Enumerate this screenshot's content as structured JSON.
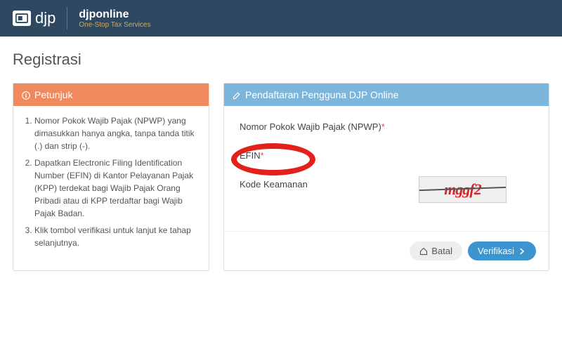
{
  "header": {
    "logo_text": "djp",
    "brand_title": "djponline",
    "brand_sub": "One-Stop Tax Services"
  },
  "page_title": "Registrasi",
  "instructions": {
    "title": "Petunjuk",
    "items": [
      "Nomor Pokok Wajib Pajak (NPWP) yang dimasukkan hanya angka, tanpa tanda titik (.) dan strip (-).",
      "Dapatkan Electronic Filing Identification Number (EFIN) di Kantor Pelayanan Pajak (KPP) terdekat bagi Wajib Pajak Orang Pribadi atau di KPP terdaftar bagi Wajib Pajak Badan.",
      "Klik tombol verifikasi untuk lanjut ke tahap selanjutnya."
    ]
  },
  "form": {
    "title": "Pendaftaran Pengguna DJP Online",
    "fields": {
      "npwp_label": "Nomor Pokok Wajib Pajak (NPWP)",
      "efin_label": "EFIN",
      "captcha_label": "Kode Keamanan",
      "captcha_value": "mggf2"
    },
    "buttons": {
      "cancel": "Batal",
      "verify": "Verifikasi"
    }
  }
}
